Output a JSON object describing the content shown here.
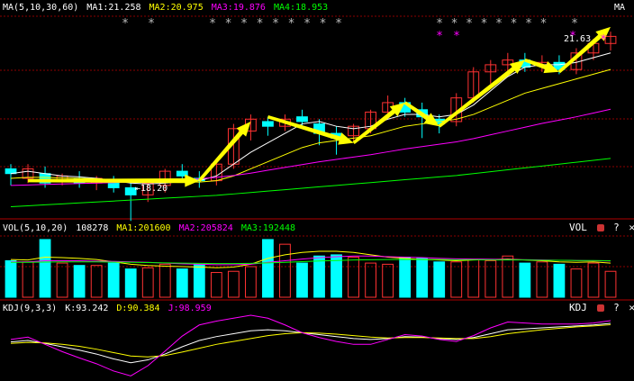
{
  "colors": {
    "background": "#000000",
    "up": "#ff3232",
    "down": "#00ffff",
    "ma1": "#ffffff",
    "ma2": "#ffff00",
    "ma3": "#ff00ff",
    "ma4": "#00ff00",
    "arrow": "#ffff00",
    "grid": "#8b0000",
    "j_line": "#ff00ff"
  },
  "price_panel": {
    "header": {
      "indicator": "MA(5,10,30,60)",
      "ma1": "MA1:21.258",
      "ma2": "MA2:20.975",
      "ma3": "MA3:19.876",
      "ma4": "MA4:18.953"
    },
    "corner_label": "MA",
    "high_label": "21.63",
    "low_label": "18.20",
    "gray_star_groups": [
      9,
      8
    ],
    "magenta_star_groups": [
      2,
      2
    ]
  },
  "vol_panel": {
    "header": {
      "indicator": "VOL(5,10,20)",
      "value": "108278",
      "ma1": "MA1:201600",
      "ma2": "MA2:205824",
      "ma3": "MA3:192448"
    },
    "corner_label": "VOL",
    "tool_help": "?",
    "tool_close": "✕"
  },
  "kdj_panel": {
    "header": {
      "indicator": "KDJ(9,3,3)",
      "k": "K:93.242",
      "d": "D:90.384",
      "j": "J:98.959"
    },
    "corner_label": "KDJ",
    "tool_help": "?",
    "tool_close": "✕"
  },
  "chart_data": {
    "type": "candlestick",
    "candles": [
      {
        "o": 19.3,
        "h": 19.4,
        "l": 18.95,
        "c": 19.2
      },
      {
        "o": 19.1,
        "h": 19.4,
        "l": 19.0,
        "c": 19.3
      },
      {
        "o": 19.2,
        "h": 19.35,
        "l": 18.9,
        "c": 19.0
      },
      {
        "o": 19.05,
        "h": 19.2,
        "l": 18.95,
        "c": 19.15
      },
      {
        "o": 19.1,
        "h": 19.25,
        "l": 18.9,
        "c": 19.0
      },
      {
        "o": 19.0,
        "h": 19.15,
        "l": 18.85,
        "c": 19.1
      },
      {
        "o": 19.05,
        "h": 19.15,
        "l": 18.8,
        "c": 18.9
      },
      {
        "o": 18.9,
        "h": 19.05,
        "l": 18.2,
        "c": 18.75
      },
      {
        "o": 18.75,
        "h": 19.05,
        "l": 18.6,
        "c": 19.0
      },
      {
        "o": 18.95,
        "h": 19.3,
        "l": 18.8,
        "c": 19.25
      },
      {
        "o": 19.25,
        "h": 19.4,
        "l": 19.05,
        "c": 19.15
      },
      {
        "o": 19.1,
        "h": 19.25,
        "l": 18.9,
        "c": 19.05
      },
      {
        "o": 19.05,
        "h": 19.5,
        "l": 18.95,
        "c": 19.4
      },
      {
        "o": 19.4,
        "h": 20.25,
        "l": 19.3,
        "c": 20.15
      },
      {
        "o": 20.1,
        "h": 20.45,
        "l": 19.9,
        "c": 20.35
      },
      {
        "o": 20.3,
        "h": 20.4,
        "l": 20.0,
        "c": 20.2
      },
      {
        "o": 20.2,
        "h": 20.45,
        "l": 20.1,
        "c": 20.35
      },
      {
        "o": 20.4,
        "h": 20.55,
        "l": 20.2,
        "c": 20.3
      },
      {
        "o": 20.25,
        "h": 20.35,
        "l": 19.8,
        "c": 20.05
      },
      {
        "o": 20.05,
        "h": 20.2,
        "l": 19.6,
        "c": 19.95
      },
      {
        "o": 20.0,
        "h": 20.25,
        "l": 19.9,
        "c": 20.2
      },
      {
        "o": 20.15,
        "h": 20.55,
        "l": 20.05,
        "c": 20.5
      },
      {
        "o": 20.5,
        "h": 20.85,
        "l": 20.35,
        "c": 20.7
      },
      {
        "o": 20.7,
        "h": 20.8,
        "l": 20.4,
        "c": 20.5
      },
      {
        "o": 20.55,
        "h": 20.7,
        "l": 19.95,
        "c": 20.4
      },
      {
        "o": 20.35,
        "h": 20.45,
        "l": 20.05,
        "c": 20.25
      },
      {
        "o": 20.3,
        "h": 20.9,
        "l": 20.2,
        "c": 20.8
      },
      {
        "o": 20.8,
        "h": 21.45,
        "l": 20.7,
        "c": 21.35
      },
      {
        "o": 21.35,
        "h": 21.6,
        "l": 21.1,
        "c": 21.5
      },
      {
        "o": 21.5,
        "h": 21.75,
        "l": 21.3,
        "c": 21.6
      },
      {
        "o": 21.6,
        "h": 21.75,
        "l": 21.35,
        "c": 21.45
      },
      {
        "o": 21.5,
        "h": 21.7,
        "l": 21.35,
        "c": 21.55
      },
      {
        "o": 21.55,
        "h": 21.7,
        "l": 21.3,
        "c": 21.4
      },
      {
        "o": 21.4,
        "h": 21.85,
        "l": 21.3,
        "c": 21.75
      },
      {
        "o": 21.75,
        "h": 22.05,
        "l": 21.6,
        "c": 21.95
      },
      {
        "o": 21.95,
        "h": 22.2,
        "l": 21.8,
        "c": 22.1
      }
    ],
    "ma_series": [
      {
        "name": "MA1",
        "values": [
          19.2,
          19.25,
          19.2,
          19.15,
          19.13,
          19.1,
          19.05,
          19.0,
          18.98,
          19.0,
          19.03,
          19.05,
          19.15,
          19.4,
          19.65,
          19.85,
          20.05,
          20.25,
          20.3,
          20.2,
          20.15,
          20.2,
          20.35,
          20.45,
          20.45,
          20.4,
          20.45,
          20.65,
          20.95,
          21.25,
          21.45,
          21.5,
          21.5,
          21.55,
          21.65,
          21.75
        ]
      },
      {
        "name": "MA2",
        "values": [
          19.1,
          19.12,
          19.12,
          19.11,
          19.1,
          19.09,
          19.07,
          19.05,
          19.03,
          19.02,
          19.02,
          19.02,
          19.05,
          19.15,
          19.3,
          19.45,
          19.6,
          19.75,
          19.85,
          19.9,
          19.95,
          20.0,
          20.1,
          20.2,
          20.25,
          20.3,
          20.35,
          20.45,
          20.6,
          20.75,
          20.9,
          21.0,
          21.1,
          21.2,
          21.3,
          21.4
        ]
      },
      {
        "name": "MA3",
        "values": [
          18.95,
          18.96,
          18.97,
          18.98,
          18.99,
          19.0,
          19.01,
          19.02,
          19.03,
          19.05,
          19.07,
          19.09,
          19.12,
          19.16,
          19.21,
          19.27,
          19.33,
          19.39,
          19.45,
          19.5,
          19.55,
          19.6,
          19.66,
          19.72,
          19.77,
          19.82,
          19.87,
          19.94,
          20.02,
          20.1,
          20.18,
          20.26,
          20.33,
          20.4,
          20.48,
          20.56
        ]
      },
      {
        "name": "MA4",
        "values": [
          18.5,
          18.52,
          18.54,
          18.56,
          18.58,
          18.6,
          18.62,
          18.64,
          18.66,
          18.68,
          18.7,
          18.72,
          18.74,
          18.77,
          18.8,
          18.83,
          18.86,
          18.89,
          18.92,
          18.95,
          18.98,
          19.01,
          19.04,
          19.07,
          19.1,
          19.13,
          19.16,
          19.2,
          19.24,
          19.28,
          19.32,
          19.36,
          19.4,
          19.44,
          19.48,
          19.52
        ]
      }
    ],
    "arrows": [
      {
        "from": [
          1,
          19.05
        ],
        "to": [
          11,
          19.05
        ]
      },
      {
        "from": [
          11,
          19.05
        ],
        "to": [
          14,
          20.3
        ]
      },
      {
        "from": [
          15,
          20.4
        ],
        "to": [
          20,
          19.85
        ]
      },
      {
        "from": [
          20,
          19.85
        ],
        "to": [
          23,
          20.7
        ]
      },
      {
        "from": [
          23,
          20.7
        ],
        "to": [
          25,
          20.2
        ]
      },
      {
        "from": [
          25,
          20.2
        ],
        "to": [
          30,
          21.6
        ]
      },
      {
        "from": [
          30,
          21.6
        ],
        "to": [
          32,
          21.35
        ]
      },
      {
        "from": [
          32,
          21.35
        ],
        "to": [
          35,
          22.3
        ]
      }
    ],
    "volume": [
      155,
      150,
      245,
      145,
      135,
      135,
      145,
      120,
      125,
      140,
      120,
      140,
      105,
      110,
      130,
      245,
      225,
      145,
      175,
      180,
      170,
      145,
      140,
      170,
      165,
      150,
      150,
      160,
      155,
      175,
      145,
      150,
      140,
      120,
      145,
      110
    ],
    "vol_ma": [
      {
        "name": "MA1",
        "values": [
          160,
          158,
          170,
          168,
          165,
          160,
          150,
          140,
          135,
          132,
          130,
          128,
          125,
          128,
          140,
          165,
          180,
          190,
          195,
          195,
          190,
          180,
          170,
          165,
          160,
          158,
          155,
          158,
          160,
          162,
          158,
          155,
          150,
          148,
          150,
          145
        ]
      },
      {
        "name": "MA2",
        "values": [
          150,
          150,
          155,
          155,
          155,
          153,
          152,
          150,
          148,
          145,
          142,
          140,
          138,
          138,
          140,
          148,
          155,
          162,
          168,
          172,
          175,
          175,
          172,
          170,
          168,
          165,
          163,
          162,
          161,
          160,
          159,
          158,
          157,
          156,
          155,
          154
        ]
      },
      {
        "name": "MA3",
        "values": [
          148,
          148,
          149,
          150,
          150,
          150,
          149,
          148,
          147,
          146,
          145,
          144,
          143,
          143,
          144,
          146,
          148,
          151,
          154,
          156,
          158,
          159,
          160,
          160,
          160,
          160,
          159,
          159,
          158,
          158,
          158,
          157,
          157,
          156,
          156,
          155
        ]
      }
    ],
    "kdj": {
      "K": [
        55,
        58,
        52,
        45,
        38,
        30,
        20,
        12,
        18,
        30,
        45,
        58,
        66,
        72,
        78,
        80,
        78,
        74,
        70,
        66,
        62,
        60,
        62,
        66,
        65,
        62,
        60,
        64,
        72,
        80,
        82,
        84,
        86,
        88,
        90,
        93.242
      ],
      "D": [
        52,
        54,
        53,
        50,
        46,
        40,
        33,
        26,
        24,
        27,
        34,
        42,
        50,
        56,
        62,
        68,
        72,
        74,
        73,
        71,
        68,
        65,
        63,
        64,
        64,
        63,
        62,
        62,
        66,
        72,
        76,
        80,
        83,
        86,
        88,
        90.384
      ],
      "J": [
        60,
        65,
        50,
        35,
        22,
        10,
        -5,
        -15,
        6,
        36,
        67,
        90,
        98,
        104,
        110,
        104,
        90,
        74,
        64,
        56,
        50,
        50,
        60,
        70,
        67,
        60,
        56,
        68,
        84,
        96,
        94,
        92,
        92,
        92,
        94,
        98.959
      ],
      "range": [
        -20,
        110
      ]
    }
  }
}
